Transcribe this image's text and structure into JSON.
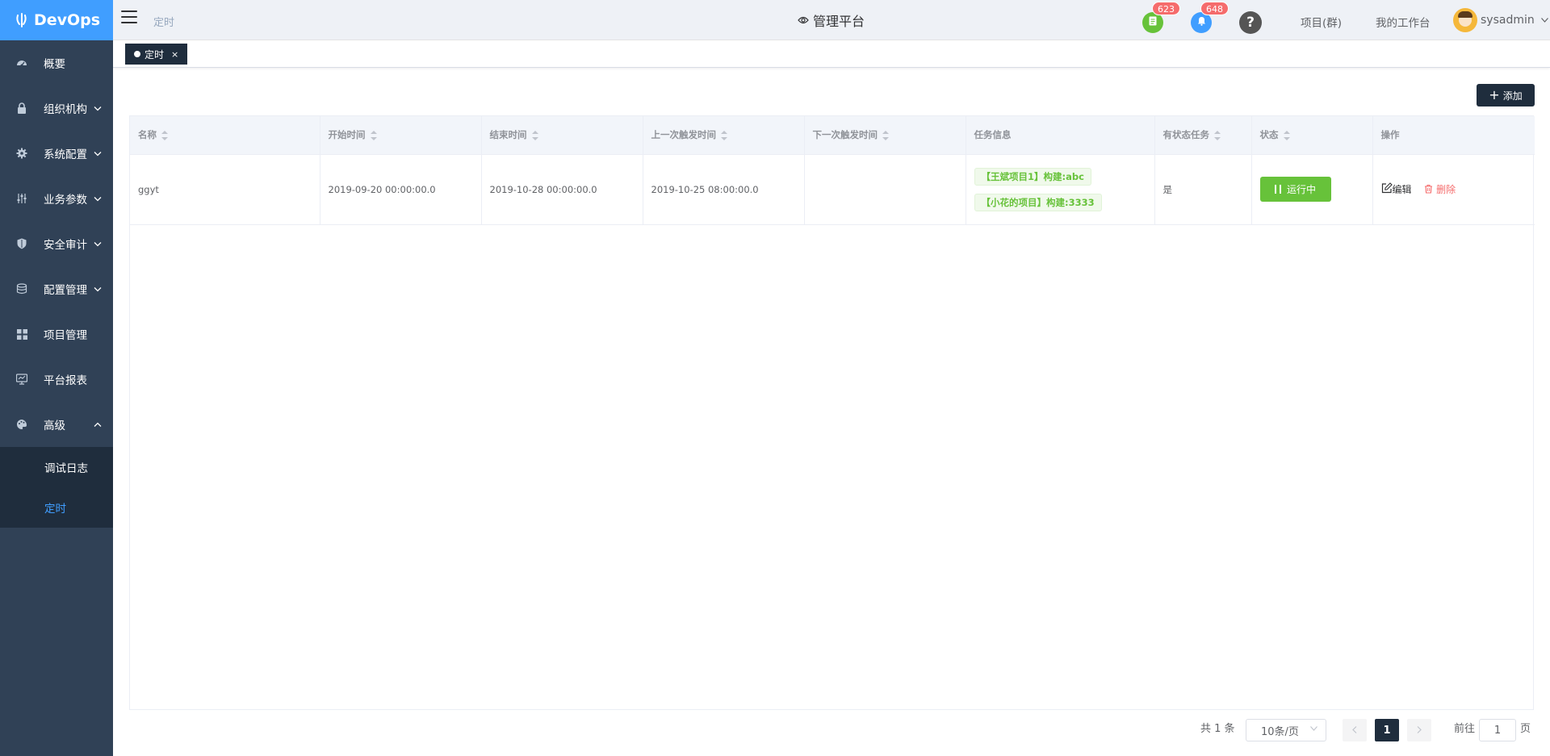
{
  "app": {
    "name": "DevOps"
  },
  "sidebar": {
    "items": [
      {
        "label": "概要",
        "icon": "dashboard-icon"
      },
      {
        "label": "组织机构",
        "icon": "lock-icon"
      },
      {
        "label": "系统配置",
        "icon": "gear-icon"
      },
      {
        "label": "业务参数",
        "icon": "sliders-icon"
      },
      {
        "label": "安全审计",
        "icon": "shield-icon"
      },
      {
        "label": "配置管理",
        "icon": "database-icon"
      },
      {
        "label": "项目管理",
        "icon": "grid-icon"
      },
      {
        "label": "平台报表",
        "icon": "monitor-icon"
      },
      {
        "label": "高级",
        "icon": "palette-icon"
      }
    ],
    "submenu": [
      {
        "label": "调试日志"
      },
      {
        "label": "定时",
        "active": true
      }
    ]
  },
  "header": {
    "breadcrumb": "定时",
    "platform_title": "管理平台",
    "notifications": [
      {
        "count": "623",
        "color": "#67c23a",
        "icon": "document-icon"
      },
      {
        "count": "648",
        "color": "#409eff",
        "icon": "bell-icon"
      }
    ],
    "help_icon": "question-icon",
    "links": {
      "projects": "项目(群)",
      "workspace": "我的工作台"
    },
    "user": {
      "name": "sysadmin"
    }
  },
  "tags": [
    {
      "label": "定时",
      "active": true
    }
  ],
  "toolbar": {
    "add_label": "添加"
  },
  "table": {
    "columns": [
      "名称",
      "开始时间",
      "结束时间",
      "上一次触发时间",
      "下一次触发时间",
      "任务信息",
      "有状态任务",
      "状态",
      "操作"
    ],
    "rows": [
      {
        "name": "ggyt",
        "start": "2019-09-20 00:00:00.0",
        "end": "2019-10-28 00:00:00.0",
        "last_trigger": "2019-10-25 08:00:00.0",
        "next_trigger": "",
        "tasks": [
          "【王斌项目1】构建:abc",
          "【小花的项目】构建:3333"
        ],
        "stateful": "是",
        "status": "运行中",
        "actions": {
          "edit": "编辑",
          "delete": "删除"
        }
      }
    ]
  },
  "pagination": {
    "total_text": "共 1 条",
    "page_size": "10条/页",
    "current_page": "1",
    "goto_prefix": "前往",
    "goto_value": "1",
    "goto_suffix": "页"
  },
  "colors": {
    "sidebar_bg": "#304156",
    "logo_bg": "#409eff",
    "accent": "#409eff",
    "success": "#67c23a",
    "danger": "#f56c6c",
    "dark": "#1f2d3d"
  }
}
